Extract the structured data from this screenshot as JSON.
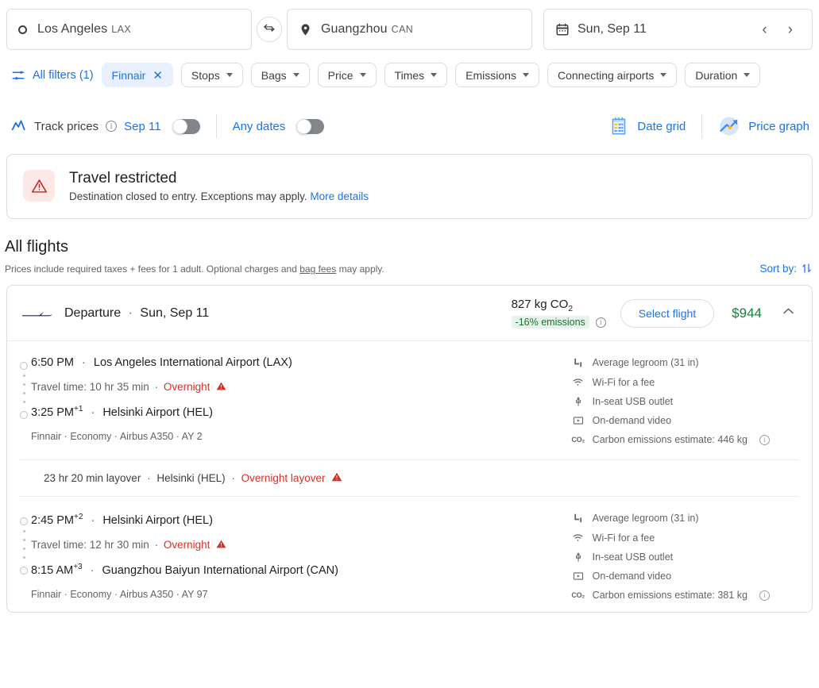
{
  "search": {
    "origin": {
      "city": "Los Angeles",
      "code": "LAX",
      "icon": "circle-dot-icon"
    },
    "destination": {
      "city": "Guangzhou",
      "code": "CAN",
      "icon": "location-pin-icon"
    },
    "swap_label": "⇄",
    "date": {
      "value": "Sun, Sep 11",
      "icon": "calendar-icon",
      "prev": "‹",
      "next": "›"
    }
  },
  "filters": {
    "all_filters_label": "All filters (1)",
    "chips": [
      {
        "label": "Finnair",
        "active": true,
        "close": "✕"
      },
      {
        "label": "Stops",
        "active": false
      },
      {
        "label": "Bags",
        "active": false
      },
      {
        "label": "Price",
        "active": false
      },
      {
        "label": "Times",
        "active": false
      },
      {
        "label": "Emissions",
        "active": false
      },
      {
        "label": "Connecting airports",
        "active": false
      },
      {
        "label": "Duration",
        "active": false
      }
    ]
  },
  "trackrow": {
    "track_prices_label": "Track prices",
    "info_char": "i",
    "date_label": "Sep 11",
    "any_dates_label": "Any dates",
    "date_grid_label": "Date grid",
    "price_graph_label": "Price graph"
  },
  "notice": {
    "title": "Travel restricted",
    "body": "Destination closed to entry. Exceptions may apply.",
    "link": "More details"
  },
  "all_flights": {
    "heading": "All flights",
    "note_prefix": "Prices include required taxes + fees for 1 adult. Optional charges and ",
    "note_link": "bag fees",
    "note_suffix": " may apply.",
    "sort_by_label": "Sort by:"
  },
  "result": {
    "header": {
      "departure_label": "Departure",
      "separator": "·",
      "date": "Sun, Sep 11",
      "co2_amount": "827 kg CO",
      "co2_sub": "2",
      "emissions_badge": "-16% emissions",
      "select_flight_label": "Select flight",
      "price": "$944",
      "collapse_icon": "chevron-up-icon"
    },
    "legs": [
      {
        "depart_time": "6:50 PM",
        "depart_sup": "",
        "depart_airport": "Los Angeles International Airport (LAX)",
        "travel_time": "Travel time: 10 hr 35 min",
        "travel_sep": "·",
        "overnight": "Overnight",
        "arrive_time": "3:25 PM",
        "arrive_sup": "+1",
        "arrive_airport": "Helsinki Airport (HEL)",
        "meta": "Finnair · Economy · Airbus A350 · AY 2",
        "amenities": [
          {
            "icon": "legroom-icon",
            "label": "Average legroom (31 in)"
          },
          {
            "icon": "wifi-icon",
            "label": "Wi-Fi for a fee"
          },
          {
            "icon": "usb-icon",
            "label": "In-seat USB outlet"
          },
          {
            "icon": "video-icon",
            "label": "On-demand video"
          },
          {
            "icon": "co2-icon",
            "label": "Carbon emissions estimate: 446 kg",
            "info": true
          }
        ]
      },
      {
        "depart_time": "2:45 PM",
        "depart_sup": "+2",
        "depart_airport": "Helsinki Airport (HEL)",
        "travel_time": "Travel time: 12 hr 30 min",
        "travel_sep": "·",
        "overnight": "Overnight",
        "arrive_time": "8:15 AM",
        "arrive_sup": "+3",
        "arrive_airport": "Guangzhou Baiyun International Airport (CAN)",
        "meta": "Finnair · Economy · Airbus A350 · AY 97",
        "amenities": [
          {
            "icon": "legroom-icon",
            "label": "Average legroom (31 in)"
          },
          {
            "icon": "wifi-icon",
            "label": "Wi-Fi for a fee"
          },
          {
            "icon": "usb-icon",
            "label": "In-seat USB outlet"
          },
          {
            "icon": "video-icon",
            "label": "On-demand video"
          },
          {
            "icon": "co2-icon",
            "label": "Carbon emissions estimate: 381 kg",
            "info": true
          }
        ]
      }
    ],
    "layover": {
      "duration": "23 hr 20 min layover",
      "sep1": "·",
      "place": "Helsinki (HEL)",
      "sep2": "·",
      "warning": "Overnight layover"
    }
  },
  "colors": {
    "accent_blue": "#1a73e8",
    "price_green": "#188038",
    "warning_red": "#d93025",
    "chip_active_bg": "#e8f0fe",
    "emissions_badge_bg": "#e6f4ea",
    "finnair_navy": "#1a2560"
  }
}
